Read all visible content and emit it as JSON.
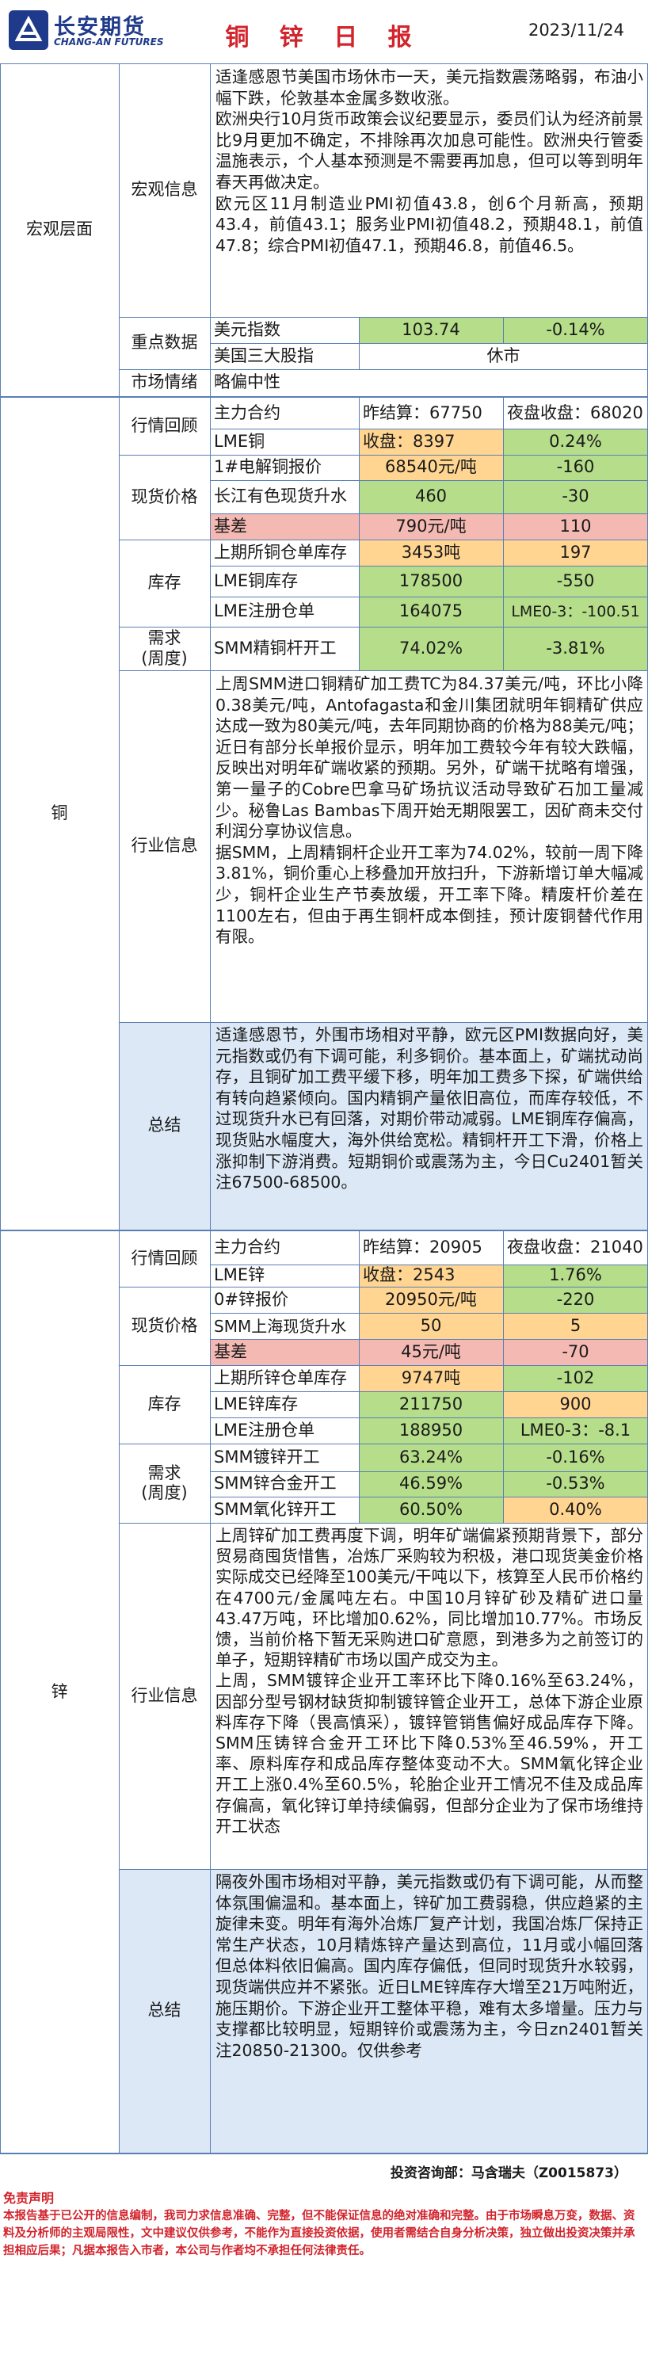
{
  "header": {
    "logo_cn": "长安期货",
    "logo_en": "CHANG-AN FUTURES",
    "title": "铜 锌 日 报",
    "date": "2023/11/24"
  },
  "macro": {
    "section": "宏观层面",
    "info_label": "宏观信息",
    "info_lines": [
      "适逢感恩节美国市场休市一天，美元指数震荡略弱，布油小幅下跌，伦敦基本金属多数收涨。",
      "欧洲央行10月货币政策会议纪要显示，委员们认为经济前景比9月更加不确定，不排除再次加息可能性。欧洲央行管委温施表示，个人基本预测是不需要再加息，但可以等到明年春天再做决定。",
      "欧元区11月制造业PMI初值43.8，创6个月新高，预期43.4，前值43.1；服务业PMI初值48.2，预期48.1，前值47.8；综合PMI初值47.1，预期46.8，前值46.5。"
    ],
    "key_label": "重点数据",
    "usd_label": "美元指数",
    "usd_value": "103.74",
    "usd_change": "-0.14%",
    "us_label": "美国三大股指",
    "us_value": "休市",
    "sentiment_label": "市场情绪",
    "sentiment_value": "略偏中性"
  },
  "copper": {
    "section": "铜",
    "market_label": "行情回顾",
    "main_contract": "主力合约",
    "settle": "昨结算：67750",
    "night": "夜盘收盘：68020",
    "lme_label": "LME铜",
    "lme_close": "收盘：8397",
    "lme_change": "0.24%",
    "spot_label": "现货价格",
    "spot1_label": "1#电解铜报价",
    "spot1_value": "68540元/吨",
    "spot1_change": "-160",
    "spot2_label": "长江有色现货升水",
    "spot2_value": "460",
    "spot2_change": "-30",
    "basis_label": "基差",
    "basis_value": "790元/吨",
    "basis_change": "110",
    "inv_label": "库存",
    "inv1_label": "上期所铜仓单库存",
    "inv1_value": "3453吨",
    "inv1_change": "197",
    "inv2_label": "LME铜库存",
    "inv2_value": "178500",
    "inv2_change": "-550",
    "inv3_label": "LME注册仓单",
    "inv3_value": "164075",
    "inv3_change": "LME0-3：-100.51",
    "demand_label_1": "需求",
    "demand_label_2": "(周度)",
    "demand1_label": "SMM精铜杆开工",
    "demand1_value": "74.02%",
    "demand1_change": "-3.81%",
    "industry_label": "行业信息",
    "industry_lines": [
      "上周SMM进口铜精矿加工费TC为84.37美元/吨，环比小降0.38美元/吨，Antofagasta和金川集团就明年铜精矿供应达成一致为80美元/吨，去年同期协商的价格为88美元/吨；近日有部分长单报价显示，明年加工费较今年有较大跌幅，反映出对明年矿端收紧的预期。另外，矿端干扰略有增强，第一量子的Cobre巴拿马矿场抗议活动导致矿石加工量减少。秘鲁Las Bambas下周开始无期限罢工，因矿商未交付利润分享协议信息。",
      "据SMM，上周精铜杆企业开工率为74.02%，较前一周下降3.81%，铜价重心上移叠加开放扫升，下游新增订单大幅减少，铜杆企业生产节奏放缓，开工率下降。精废杆价差在1100左右，但由于再生铜杆成本倒挂，预计废铜替代作用有限。"
    ],
    "summary_label": "总结",
    "summary_text": "适逢感恩节，外围市场相对平静，欧元区PMI数据向好，美元指数或仍有下调可能，利多铜价。基本面上，矿端扰动尚存，且铜矿加工费平缓下移，明年加工费多下探，矿端供给有转向趋紧倾向。国内精铜产量依旧高位，而库存较低，不过现货升水已有回落，对期价带动减弱。LME铜库存偏高，现货贴水幅度大，海外供给宽松。精铜杆开工下滑，价格上涨抑制下游消费。短期铜价或震荡为主，今日Cu2401暂关注67500-68500。"
  },
  "zinc": {
    "section": "锌",
    "market_label": "行情回顾",
    "main_contract": "主力合约",
    "settle": "昨结算：20905",
    "night": "夜盘收盘：21040",
    "lme_label": "LME锌",
    "lme_close": "收盘：2543",
    "lme_change": "1.76%",
    "spot_label": "现货价格",
    "spot1_label": "0#锌报价",
    "spot1_value": "20950元/吨",
    "spot1_change": "-220",
    "spot2_label": "SMM上海现货升水",
    "spot2_value": "50",
    "spot2_change": "5",
    "basis_label": "基差",
    "basis_value": "45元/吨",
    "basis_change": "-70",
    "inv_label": "库存",
    "inv1_label": "上期所锌仓单库存",
    "inv1_value": "9747吨",
    "inv1_change": "-102",
    "inv2_label": "LME锌库存",
    "inv2_value": "211750",
    "inv2_change": "900",
    "inv3_label": "LME注册仓单",
    "inv3_value": "188950",
    "inv3_change": "LME0-3：-8.1",
    "demand_label_1": "需求",
    "demand_label_2": "(周度)",
    "demand1_label": "SMM镀锌开工",
    "demand1_value": "63.24%",
    "demand1_change": "-0.16%",
    "demand2_label": "SMM锌合金开工",
    "demand2_value": "46.59%",
    "demand2_change": "-0.53%",
    "demand3_label": "SMM氧化锌开工",
    "demand3_value": "60.50%",
    "demand3_change": "0.40%",
    "industry_label": "行业信息",
    "industry_lines": [
      "上周锌矿加工费再度下调，明年矿端偏紧预期背景下，部分贸易商囤货惜售，冶炼厂采购较为积极，港口现货美金价格实际成交已经降至100美元/干吨以下，核算至人民币价格约在4700元/金属吨左右。中国10月锌矿砂及精矿进口量43.47万吨，环比增加0.62%，同比增加10.77%。市场反馈，当前价格下暂无采购进口矿意愿，到港多为之前签订的单子，短期锌精矿市场以国产成交为主。",
      "上周，SMM镀锌企业开工率环比下降0.16%至63.24%，因部分型号钢材缺货抑制镀锌管企业开工，总体下游企业原料库存下降（畏高慎采），镀锌管销售偏好成品库存下降。SMM压铸锌合金开工环比下降0.53%至46.59%，开工率、原料库存和成品库存整体变动不大。SMM氧化锌企业开工上涨0.4%至60.5%，轮胎企业开工情况不佳及成品库存偏高，氧化锌订单持续偏弱，但部分企业为了保市场维持开工状态"
    ],
    "summary_label": "总结",
    "summary_text": "隔夜外围市场相对平静，美元指数或仍有下调可能，从而整体氛围偏温和。基本面上，锌矿加工费弱稳，供应趋紧的主旋律未变。明年有海外冶炼厂复产计划，我国冶炼厂保持正常生产状态，10月精炼锌产量达到高位，11月或小幅回落但总体料依旧偏高。国内库存偏低，但同时现货升水较弱，现货端供应并不紧张。近日LME锌库存大增至21万吨附近，施压期价。下游企业开工整体平稳，难有太多增量。压力与支撑都比较明显，短期锌价或震荡为主，今日zn2401暂关注20850-21300。仅供参考"
  },
  "footer": {
    "advisor": "投资咨询部：马含瑞夫（Z0015873）",
    "disclaimer_title": "免责声明",
    "disclaimer_text": "本报告基于已公开的信息编制，我司力求信息准确、完整，但不能保证信息的绝对准确和完整。由于市场瞬息万变，数据、资料及分析师的主观局限性，文中建议仅供参考，不能作为直接投资依据，使用者需结合自身分析决策，独立做出投资决策并承担相应后果；凡据本报告入市者，本公司与作者均不承担任何法律责任。"
  },
  "colors": {
    "border": "#5a7fb5",
    "title_red": "#d2242c",
    "logo_blue": "#1f3a8a",
    "green": "#b5dd8a",
    "yellow": "#ffd591",
    "pink": "#f4b9b3",
    "summary_bg": "#dce8f6"
  }
}
